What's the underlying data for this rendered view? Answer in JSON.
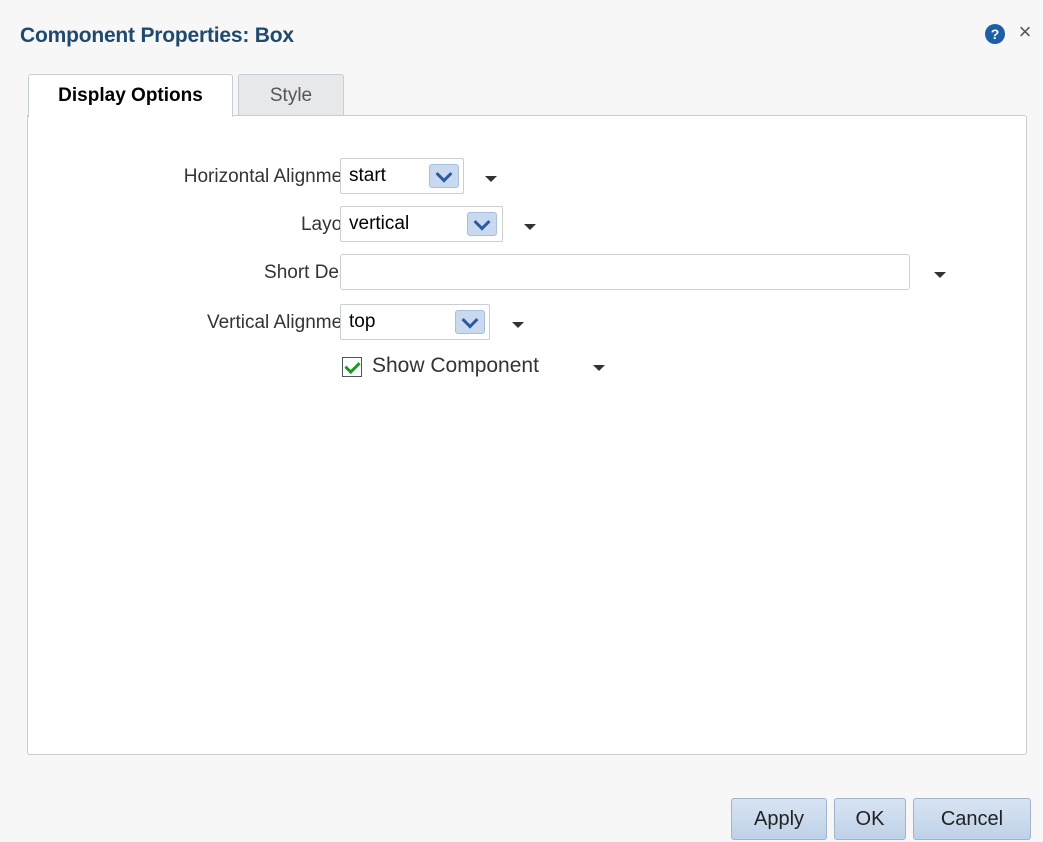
{
  "dialog": {
    "title": "Component Properties: Box",
    "help_icon": "question-circle-icon",
    "help_glyph": "?",
    "close_glyph": "×"
  },
  "tabs": [
    {
      "label": "Display Options",
      "active": true
    },
    {
      "label": "Style",
      "active": false
    }
  ],
  "form": {
    "horizontal_alignment": {
      "label": "Horizontal Alignment",
      "value": "start"
    },
    "layout": {
      "label": "Layout",
      "value": "vertical"
    },
    "short_desc": {
      "label": "Short Desc",
      "value": ""
    },
    "vertical_alignment": {
      "label": "Vertical Alignment",
      "value": "top"
    },
    "show_component": {
      "label": "Show Component",
      "checked": true
    }
  },
  "buttons": {
    "apply": "Apply",
    "ok": "OK",
    "cancel": "Cancel"
  },
  "colors": {
    "title": "#1f4a6e",
    "button_bg": "#c9daf0",
    "check": "#1a9a2a"
  }
}
